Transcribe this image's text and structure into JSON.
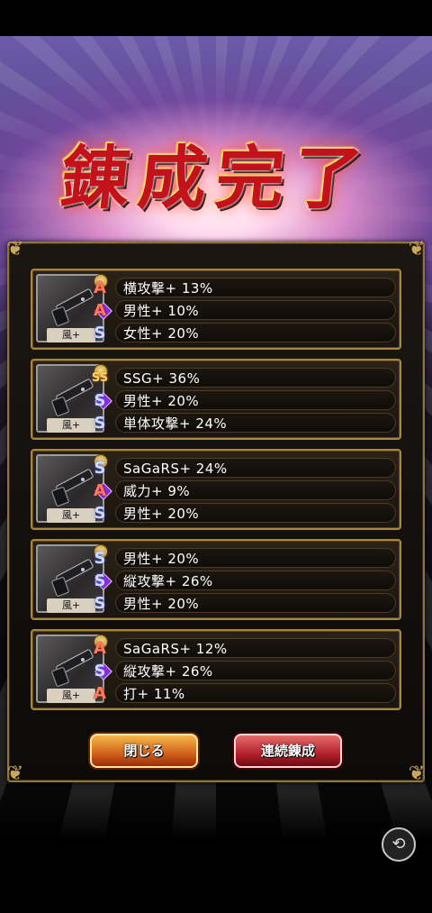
{
  "title": "錬成完了",
  "cards": [
    {
      "element_tag": "風+",
      "stats": [
        {
          "icon": "A",
          "text": "横攻撃+ 13%"
        },
        {
          "icon": "A",
          "text": "男性+ 10%"
        },
        {
          "icon": "S",
          "text": "女性+ 20%"
        }
      ]
    },
    {
      "element_tag": "風+",
      "stats": [
        {
          "icon": "SS",
          "text": "SSG+ 36%"
        },
        {
          "icon": "S",
          "text": "男性+ 20%"
        },
        {
          "icon": "S",
          "text": "単体攻撃+ 24%"
        }
      ]
    },
    {
      "element_tag": "風+",
      "stats": [
        {
          "icon": "S",
          "text": "SaGaRS+ 24%"
        },
        {
          "icon": "A",
          "text": "威力+ 9%"
        },
        {
          "icon": "S",
          "text": "男性+ 20%"
        }
      ]
    },
    {
      "element_tag": "風+",
      "stats": [
        {
          "icon": "S",
          "text": "男性+ 20%"
        },
        {
          "icon": "S",
          "text": "縦攻撃+ 26%"
        },
        {
          "icon": "S",
          "text": "男性+ 20%"
        }
      ]
    },
    {
      "element_tag": "風+",
      "stats": [
        {
          "icon": "A",
          "text": "SaGaRS+ 12%"
        },
        {
          "icon": "S",
          "text": "縦攻撃+ 26%"
        },
        {
          "icon": "A",
          "text": "打+ 11%"
        }
      ]
    }
  ],
  "buttons": {
    "close_label": "閉じる",
    "repeat_label": "連続錬成"
  },
  "share_icon": "share-icon"
}
